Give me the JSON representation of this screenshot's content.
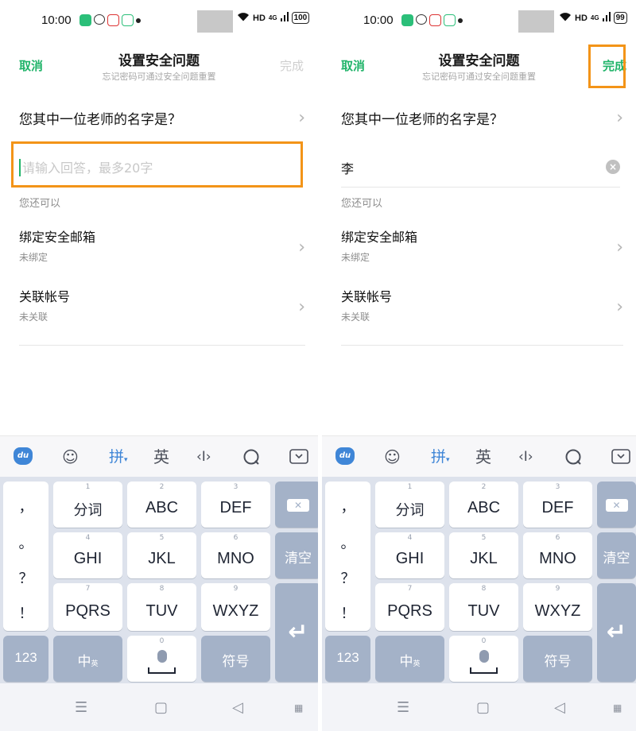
{
  "status_bar": {
    "time": "10:00",
    "net": "HD",
    "signal": "4G",
    "battery_left": "100",
    "battery_right": "99"
  },
  "header": {
    "cancel": "取消",
    "title": "设置安全问题",
    "subtitle": "忘记密码可通过安全问题重置",
    "done": "完成"
  },
  "question": "您其中一位老师的名字是？",
  "answer": {
    "placeholder": "请输入回答，最多20字",
    "left_value": "",
    "right_value": "李"
  },
  "section_label": "您还可以",
  "items": [
    {
      "title": "绑定安全邮箱",
      "sub": "未绑定"
    },
    {
      "title": "关联帐号",
      "sub": "未关联"
    }
  ],
  "colors": {
    "accent": "#21b46a",
    "highlight": "#f39418",
    "key_dark": "#a4b2c8",
    "keyboard_bg": "#dde2ec"
  },
  "keyboard": {
    "toolbar": {
      "logo": "du",
      "pinyin": "拼",
      "english": "英",
      "icons": [
        "emoji-icon",
        "cursor-icon",
        "search-icon",
        "collapse-icon"
      ]
    },
    "punct": [
      "，",
      "。",
      "？",
      "！"
    ],
    "rows": [
      [
        {
          "num": "1",
          "label": "分词"
        },
        {
          "num": "2",
          "label": "ABC"
        },
        {
          "num": "3",
          "label": "DEF"
        }
      ],
      [
        {
          "num": "4",
          "label": "GHI"
        },
        {
          "num": "5",
          "label": "JKL"
        },
        {
          "num": "6",
          "label": "MNO"
        }
      ],
      [
        {
          "num": "7",
          "label": "PQRS"
        },
        {
          "num": "8",
          "label": "TUV"
        },
        {
          "num": "9",
          "label": "WXYZ"
        }
      ]
    ],
    "clear": "清空",
    "num_key": "123",
    "lang_key": "中",
    "lang_key_sub": "英",
    "space_num": "0",
    "symbol_key": "符号"
  }
}
